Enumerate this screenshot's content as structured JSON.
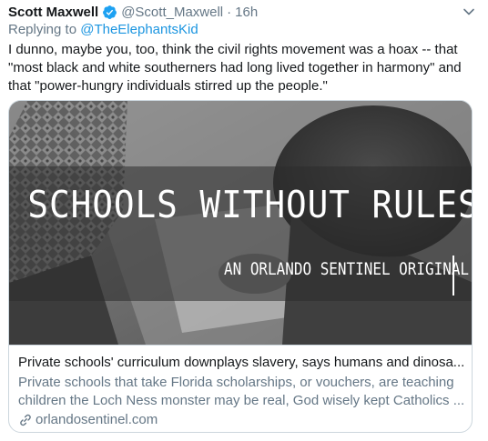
{
  "tweet": {
    "author_name": "Scott Maxwell",
    "handle": "@Scott_Maxwell",
    "separator": "·",
    "time": "16h",
    "reply_prefix": "Replying to",
    "reply_to": "@TheElephantsKid",
    "text": "I dunno, maybe you, too, think the civil rights movement was a hoax -- that \"most black and white southerners had long lived together in harmony\" and that \"power-hungry individuals stirred up the people.\""
  },
  "card": {
    "image_headline": "SCHOOLS WITHOUT RULES",
    "image_subheadline": "AN ORLANDO SENTINEL ORIGINAL",
    "title": "Private schools' curriculum downplays slavery, says humans and dinosa...",
    "description": "Private schools that take Florida scholarships, or vouchers, are teaching children the Loch Ness monster may be real, God wisely kept Catholics ...",
    "domain": "orlandosentinel.com"
  },
  "colors": {
    "verified": "#1da1f2",
    "link": "#1b95e0",
    "secondary_text": "#657786",
    "border": "#ccd6dd"
  },
  "icons": {
    "verified": "verified-badge-icon",
    "caret": "chevron-down-icon",
    "link": "link-icon"
  }
}
